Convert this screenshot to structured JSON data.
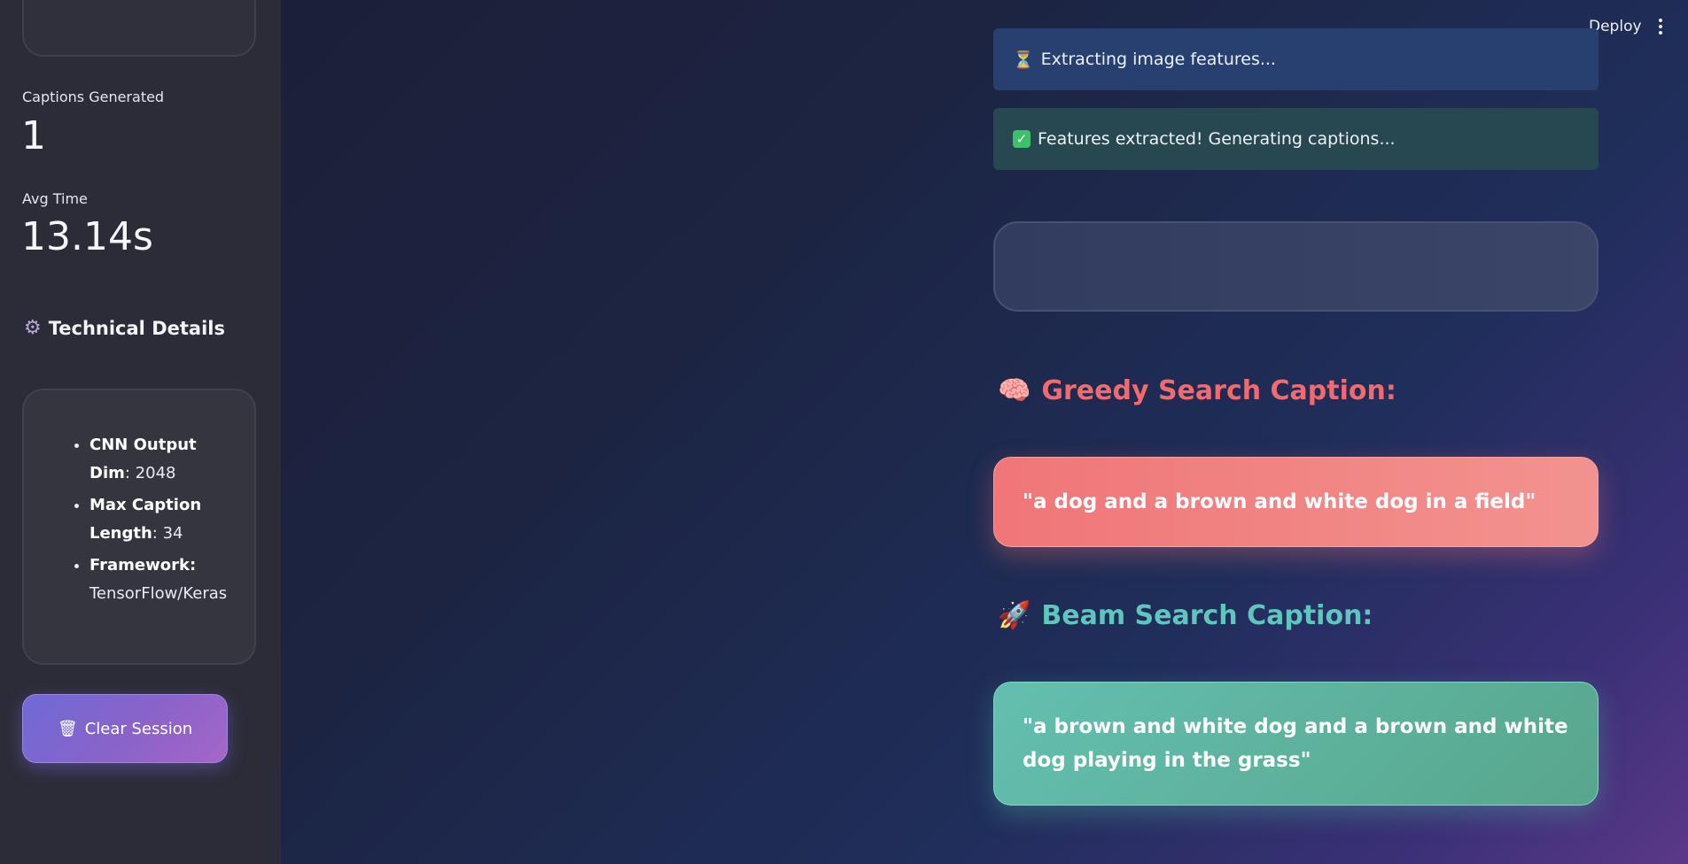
{
  "sidebar": {
    "metrics": [
      {
        "label": "Captions Generated",
        "value": "1"
      },
      {
        "label": "Avg Time",
        "value": "13.14s"
      }
    ],
    "technical_details": {
      "heading": "Technical Details",
      "icon": "gear-icon",
      "items": [
        {
          "label": "CNN Output Dim",
          "value": ": 2048"
        },
        {
          "label": "Max Caption Length",
          "value": ": 34"
        },
        {
          "label": "Framework:",
          "value": " TensorFlow/Keras"
        }
      ]
    },
    "clear_button": {
      "icon": "wastebasket-icon",
      "label": "Clear Session"
    }
  },
  "header": {
    "deploy_label": "Deploy",
    "menu_icon": "kebab-menu-icon"
  },
  "main": {
    "status_info": {
      "icon": "hourglass-icon",
      "text": "Extracting image features..."
    },
    "status_success": {
      "icon": "check-icon",
      "text": "Features extracted! Generating captions..."
    },
    "greedy": {
      "icon": "brain-icon",
      "heading": "Greedy Search Caption:",
      "caption": "\"a dog and a brown and white dog in a field\""
    },
    "beam": {
      "icon": "rocket-icon",
      "heading": "Beam Search Caption:",
      "caption": "\"a brown and white dog and a brown and white dog playing in the grass\""
    }
  },
  "colors": {
    "sidebar_bg": "#2b2c37",
    "greedy_accent": "#f06a6e",
    "beam_accent": "#5fc6bd",
    "button_gradient": "#7b66d2"
  }
}
